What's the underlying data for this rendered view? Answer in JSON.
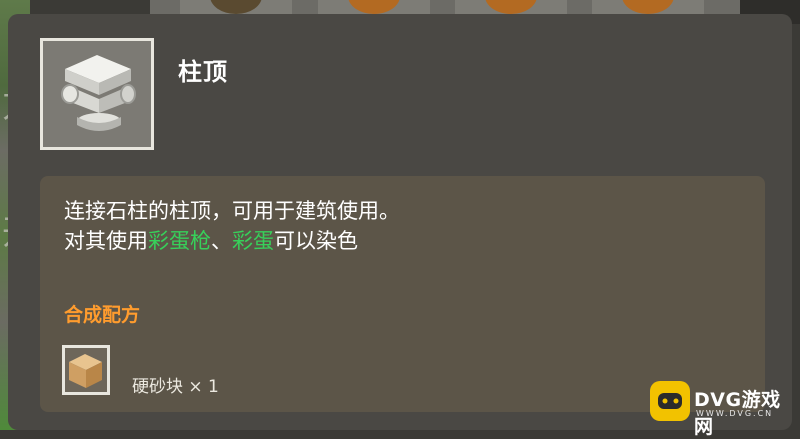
{
  "item": {
    "name": "柱顶",
    "icon": "pillar-capital-block-icon",
    "description_line1": "连接石柱的柱顶，可用于建筑使用。",
    "description_line2_prefix": "对其使用",
    "description_line2_link1": "彩蛋枪",
    "description_line2_sep": "、",
    "description_line2_link2": "彩蛋",
    "description_line2_suffix": "可以染色"
  },
  "recipe": {
    "label": "合成配方",
    "materials": [
      {
        "name": "硬砂块",
        "quantity": "× 1",
        "icon": "hard-sand-block-icon"
      }
    ]
  },
  "background": {
    "left_chars": [
      "方",
      "开"
    ]
  },
  "watermark": {
    "text": "DVG游戏网",
    "sub": "WWW.DVG.CN"
  },
  "colors": {
    "panel": "#4a4844",
    "desc_box": "#5c5548",
    "highlight_green": "#37d05a",
    "recipe_orange": "#ff9c2e"
  }
}
